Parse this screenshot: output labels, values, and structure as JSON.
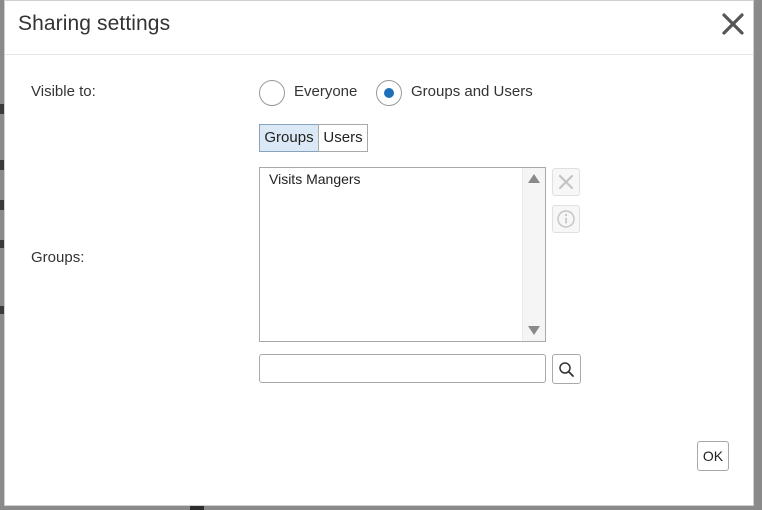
{
  "dialog": {
    "title": "Sharing settings",
    "close_icon": "close-icon"
  },
  "visibility": {
    "label": "Visible to:",
    "options": [
      {
        "label": "Everyone",
        "selected": false
      },
      {
        "label": "Groups and Users",
        "selected": true
      }
    ]
  },
  "tabs": {
    "items": [
      {
        "label": "Groups",
        "active": true
      },
      {
        "label": "Users",
        "active": false
      }
    ]
  },
  "groups": {
    "label": "Groups:",
    "items": [
      "Visits Mangers"
    ],
    "remove_icon": "close-icon",
    "info_icon": "info-icon"
  },
  "search": {
    "value": "",
    "placeholder": "",
    "icon": "search-icon"
  },
  "footer": {
    "ok_label": "OK"
  },
  "colors": {
    "accent": "#1f6fb8",
    "active_tab_bg": "#dbe8f5",
    "overlay": "#7d7d7d"
  }
}
